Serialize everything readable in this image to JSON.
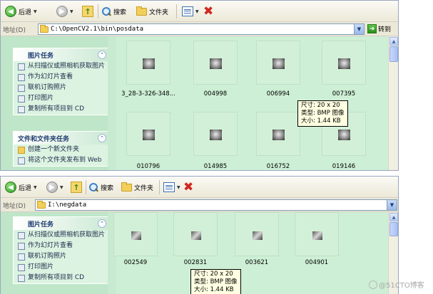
{
  "window1": {
    "toolbar": {
      "back": "后退",
      "search": "搜索",
      "folders": "文件夹"
    },
    "address": {
      "label": "地址(D)",
      "path": "C:\\OpenCV2.1\\bin\\posdata",
      "go": "转到"
    },
    "picture_tasks": {
      "title": "图片任务",
      "items": [
        "从扫描仪或照相机获取图片",
        "作为幻灯片查看",
        "联机订购照片",
        "打印图片",
        "复制所有项目到 CD"
      ]
    },
    "file_tasks": {
      "title": "文件和文件夹任务",
      "items": [
        "创建一个新文件夹",
        "将这个文件夹发布到 Web"
      ]
    },
    "files": [
      "3_28-3-326-348...",
      "004998",
      "006994",
      "007395",
      "010796",
      "014985",
      "016752",
      "019146"
    ],
    "tooltip": {
      "size": "尺寸: 20 x 20",
      "type": "类型: BMP 图像",
      "filesize": "大小: 1.44 KB"
    }
  },
  "window2": {
    "toolbar": {
      "back": "后退",
      "search": "搜索",
      "folders": "文件夹"
    },
    "address": {
      "label": "地址(D)",
      "path": "I:\\negdata"
    },
    "picture_tasks": {
      "title": "图片任务",
      "items": [
        "从扫描仪或照相机获取图片",
        "作为幻灯片查看",
        "联机订购照片",
        "打印图片",
        "复制所有项目到 CD"
      ]
    },
    "files": [
      "002549",
      "002831",
      "003621",
      "004901"
    ],
    "tooltip": {
      "size": "尺寸: 20 x 20",
      "type": "类型: BMP 图像",
      "filesize": "大小: 1.44 KB"
    }
  },
  "watermark": "@51CTO博客",
  "icons": {
    "back": "back-arrow-icon",
    "forward": "forward-arrow-icon",
    "up": "up-folder-icon",
    "search": "search-icon",
    "folders": "folder-icon",
    "views": "views-icon",
    "close": "close-x-icon",
    "go": "go-arrow-icon"
  },
  "colors": {
    "content_bg": "#cdefd5",
    "close_red": "#d0271f",
    "address_border": "#7f9db9"
  }
}
